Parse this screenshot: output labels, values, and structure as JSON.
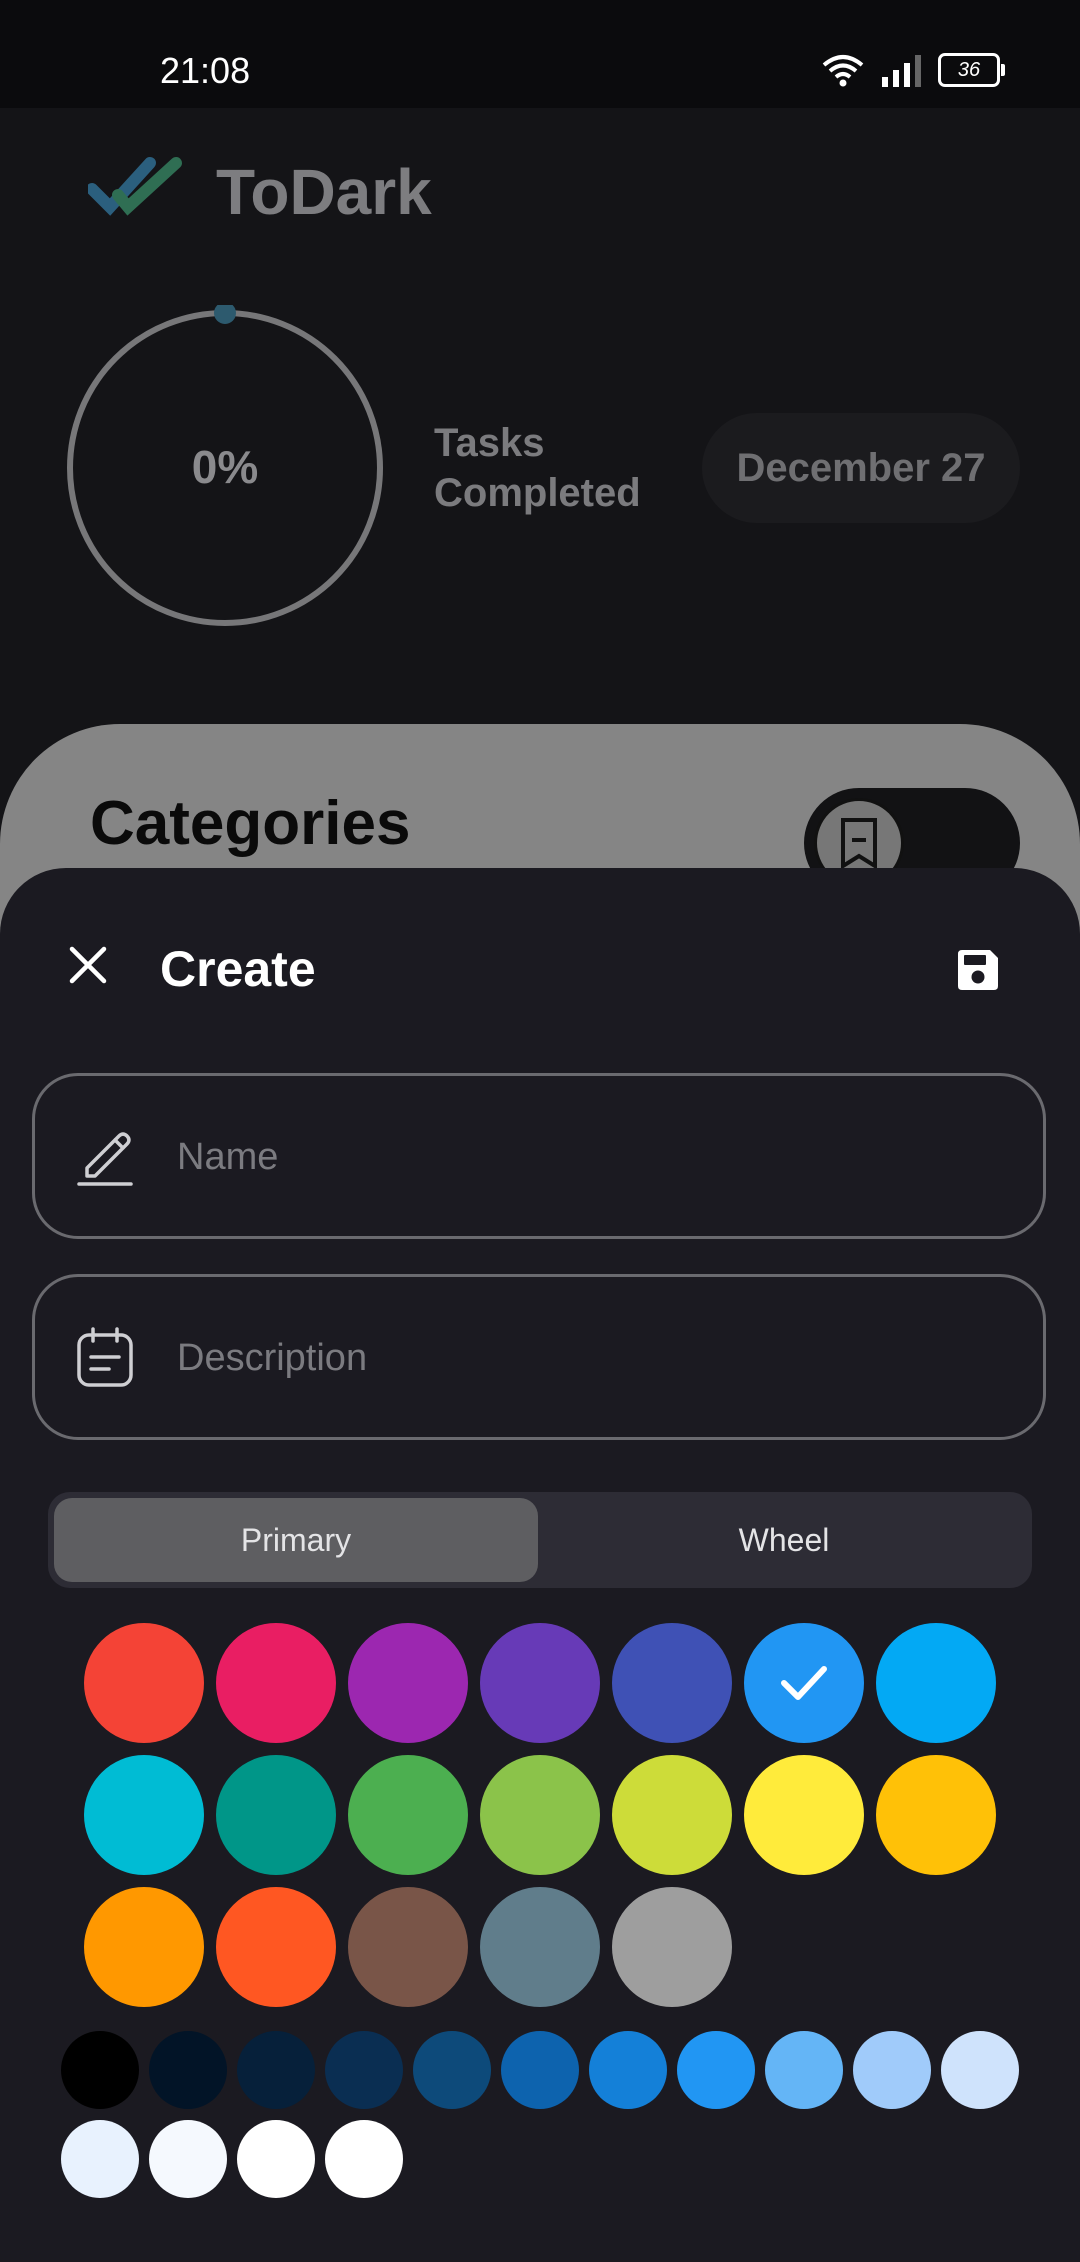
{
  "status_bar": {
    "time": "21:08",
    "battery": "36"
  },
  "app": {
    "title": "ToDark",
    "progress_percent": "0%",
    "progress_value": 0,
    "tasks_label": "Tasks Completed",
    "date": "December 27",
    "categories_title": "Categories"
  },
  "sheet": {
    "title": "Create",
    "close_icon": "close-icon",
    "save_icon": "save-icon",
    "name_placeholder": "Name",
    "description_placeholder": "Description",
    "tabs": {
      "primary": "Primary",
      "wheel": "Wheel"
    },
    "selected_color": "#2196F3",
    "primary_colors": [
      "#F44336",
      "#E91E63",
      "#9C27B0",
      "#673AB7",
      "#3F51B5",
      "#2196F3",
      "#03A9F4",
      "#00BCD4",
      "#009688",
      "#4CAF50",
      "#8BC34A",
      "#CDDC39",
      "#FFEB3B",
      "#FFC107",
      "#FF9800",
      "#FF5722",
      "#795548",
      "#607D8B",
      "#9E9E9E"
    ],
    "shade_colors": [
      "#000000",
      "#021427",
      "#06203A",
      "#0A2E52",
      "#0D4A7A",
      "#0D63AE",
      "#1480D8",
      "#2196F3",
      "#64B5F6",
      "#A0CBFA",
      "#CFE3FC",
      "#E8F2FE",
      "#F5F9FE",
      "#FFFFFF",
      "#FFFFFF"
    ]
  }
}
